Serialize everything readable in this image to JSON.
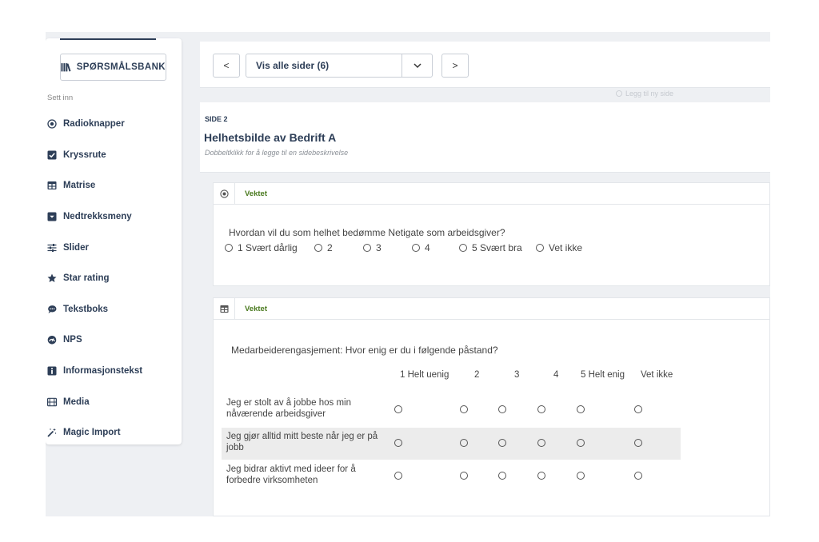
{
  "sidebar": {
    "question_bank_label": "SPØRSMÅLSBANK",
    "insert_label": "Sett inn",
    "items": [
      {
        "label": "Radioknapper",
        "icon": "radio-icon"
      },
      {
        "label": "Kryssrute",
        "icon": "checkbox-icon"
      },
      {
        "label": "Matrise",
        "icon": "matrix-icon"
      },
      {
        "label": "Nedtrekksmeny",
        "icon": "dropdown-icon"
      },
      {
        "label": "Slider",
        "icon": "slider-icon"
      },
      {
        "label": "Star rating",
        "icon": "star-icon"
      },
      {
        "label": "Tekstboks",
        "icon": "speech-bubble-icon"
      },
      {
        "label": "NPS",
        "icon": "gauge-icon"
      },
      {
        "label": "Informasjonstekst",
        "icon": "info-icon"
      },
      {
        "label": "Media",
        "icon": "film-icon"
      },
      {
        "label": "Magic Import",
        "icon": "magic-wand-icon"
      }
    ]
  },
  "toolbar": {
    "prev_symbol": "<",
    "next_symbol": ">",
    "page_select_value": "Vis alle sider (6)",
    "add_page_label": "Legg til ny side"
  },
  "page": {
    "side_label": "SIDE 2",
    "title": "Helhetsbilde av Bedrift A",
    "description": "Dobbeltklikk for å legge til en sidebeskrivelse"
  },
  "question1": {
    "tag": "Vektet",
    "text": "Hvordan vil du som helhet bedømme Netigate som arbeidsgiver?",
    "options": [
      "1 Svært dårlig",
      "2",
      "3",
      "4",
      "5 Svært bra",
      "Vet ikke"
    ]
  },
  "question2": {
    "tag": "Vektet",
    "text": "Medarbeiderengasjement: Hvor enig er du i følgende påstand?",
    "columns": [
      "1 Helt uenig",
      "2",
      "3",
      "4",
      "5 Helt enig",
      "Vet ikke"
    ],
    "rows": [
      "Jeg er stolt av å jobbe hos min nåværende arbeidsgiver",
      "Jeg gjør alltid mitt beste når jeg er på jobb",
      "Jeg bidrar aktivt med ideer for å forbedre virksomheten"
    ]
  },
  "colors": {
    "navy": "#2d3e57",
    "tag_green": "#4a7a1f",
    "background": "#eef0f3"
  }
}
